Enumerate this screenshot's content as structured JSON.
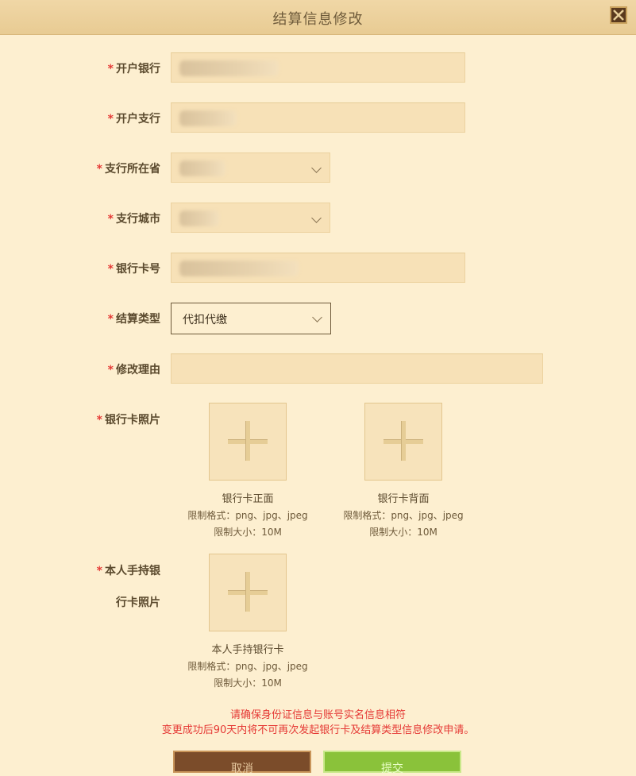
{
  "dialog": {
    "title": "结算信息修改",
    "close_icon": "close-icon"
  },
  "required_mark": "*",
  "form": {
    "bank_label": "开户银行",
    "branch_label": "开户支行",
    "province_label": "支行所在省",
    "city_label": "支行城市",
    "card_no_label": "银行卡号",
    "settle_type_label": "结算类型",
    "settle_type_value": "代扣代缴",
    "reason_label": "修改理由",
    "card_photo_label": "银行卡照片",
    "handheld_label_line1": "本人手持银",
    "handheld_label_line2": "行卡照片"
  },
  "uploads": {
    "front": {
      "name": "银行卡正面",
      "formats": "限制格式：png、jpg、jpeg",
      "size": "限制大小：10M"
    },
    "back": {
      "name": "银行卡背面",
      "formats": "限制格式：png、jpg、jpeg",
      "size": "限制大小：10M"
    },
    "handheld": {
      "name": "本人手持银行卡",
      "formats": "限制格式：png、jpg、jpeg",
      "size": "限制大小：10M"
    }
  },
  "notice": {
    "line1": "请确保身份证信息与账号实名信息相符",
    "line2": "变更成功后90天内将不可再次发起银行卡及结算类型信息修改申请。"
  },
  "buttons": {
    "cancel": "取消",
    "submit": "提交"
  },
  "colors": {
    "accent_red": "#e53935",
    "background": "#fdefd0",
    "titlebar": "#ecd09b",
    "submit_green": "#8ac23a",
    "cancel_brown": "#7b4c2a"
  }
}
